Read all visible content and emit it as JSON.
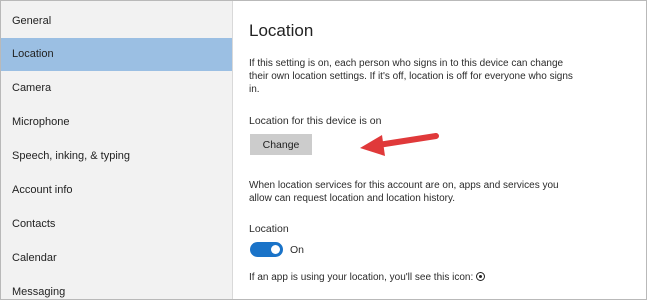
{
  "sidebar": {
    "items": [
      {
        "label": "General",
        "selected": false
      },
      {
        "label": "Location",
        "selected": true
      },
      {
        "label": "Camera",
        "selected": false
      },
      {
        "label": "Microphone",
        "selected": false
      },
      {
        "label": "Speech, inking, & typing",
        "selected": false
      },
      {
        "label": "Account info",
        "selected": false
      },
      {
        "label": "Contacts",
        "selected": false
      },
      {
        "label": "Calendar",
        "selected": false
      },
      {
        "label": "Messaging",
        "selected": false
      }
    ]
  },
  "main": {
    "title": "Location",
    "description": "If this setting is on, each person who signs in to this device can change their own location settings. If it's off, location is off for everyone who signs in.",
    "device_status": "Location for this device is on",
    "change_label": "Change",
    "account_description": "When location services for this account are on, apps and services you allow can request location and location history.",
    "location_label": "Location",
    "toggle_state": "On",
    "icon_note": "If an app is using your location, you'll see this icon:"
  },
  "colors": {
    "selected_item": "#9bbfe3",
    "toggle_on": "#1a73c8",
    "annotation_arrow": "#e0393a"
  }
}
